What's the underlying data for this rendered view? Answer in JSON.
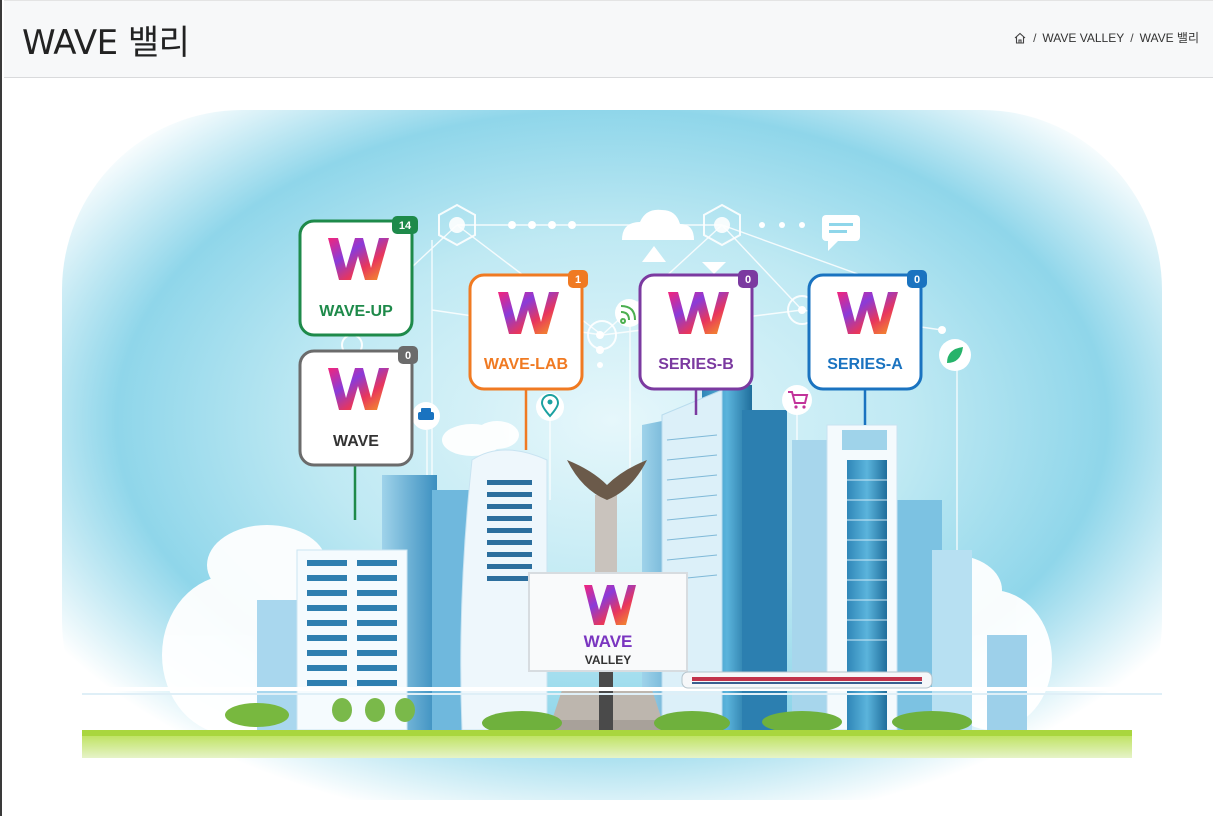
{
  "header": {
    "title": "WAVE 밸리",
    "breadcrumb": [
      "WAVE VALLEY",
      "WAVE 밸리"
    ]
  },
  "billboard": {
    "line1": "WAVE",
    "line2": "VALLEY"
  },
  "nodes": [
    {
      "label": "WAVE-UP",
      "count": "14",
      "color": "#1e8a4a"
    },
    {
      "label": "WAVE",
      "count": "0",
      "color": "#6b6b6b"
    },
    {
      "label": "WAVE-LAB",
      "count": "1",
      "color": "#f07a22"
    },
    {
      "label": "SERIES-B",
      "count": "0",
      "color": "#7b3aa0"
    },
    {
      "label": "SERIES-A",
      "count": "0",
      "color": "#1a73c0"
    }
  ],
  "icons": [
    "home-icon",
    "wifi-icon",
    "location-pin-icon",
    "taxi-icon",
    "cart-icon",
    "leaf-icon",
    "chat-icon",
    "cloud-icon"
  ]
}
